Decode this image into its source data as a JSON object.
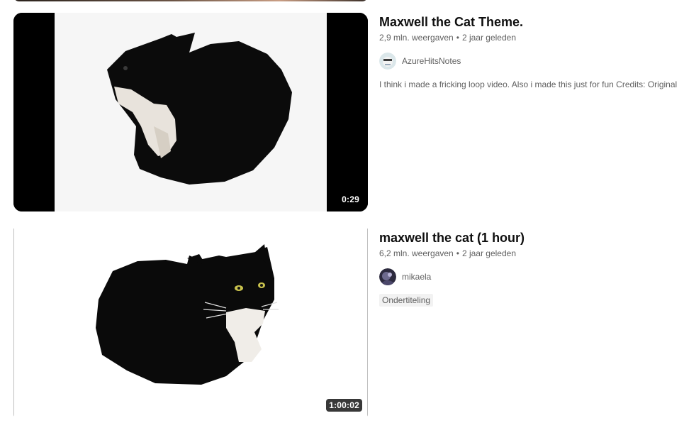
{
  "videos": [
    {
      "title": "Maxwell the Cat Theme.",
      "views": "2,9 mln. weergaven",
      "age": "2 jaar geleden",
      "channel": "AzureHitsNotes",
      "description": "I think i made a fricking loop video. Also i made this just for fun Credits: Original",
      "duration": "0:29",
      "badge": ""
    },
    {
      "title": "maxwell the cat (1 hour)",
      "views": "6,2 mln. weergaven",
      "age": "2 jaar geleden",
      "channel": "mikaela",
      "description": "",
      "duration": "1:00:02",
      "badge": "Ondertiteling"
    }
  ],
  "colors": {
    "title": "#0f0f0f",
    "secondary": "#606060",
    "badge_bg": "#f2f2f2",
    "duration_bg": "#000000cc"
  },
  "icons": {
    "avatar_1": "azurehitsnotes-avatar",
    "avatar_2": "mikaela-avatar"
  },
  "separator": "•"
}
